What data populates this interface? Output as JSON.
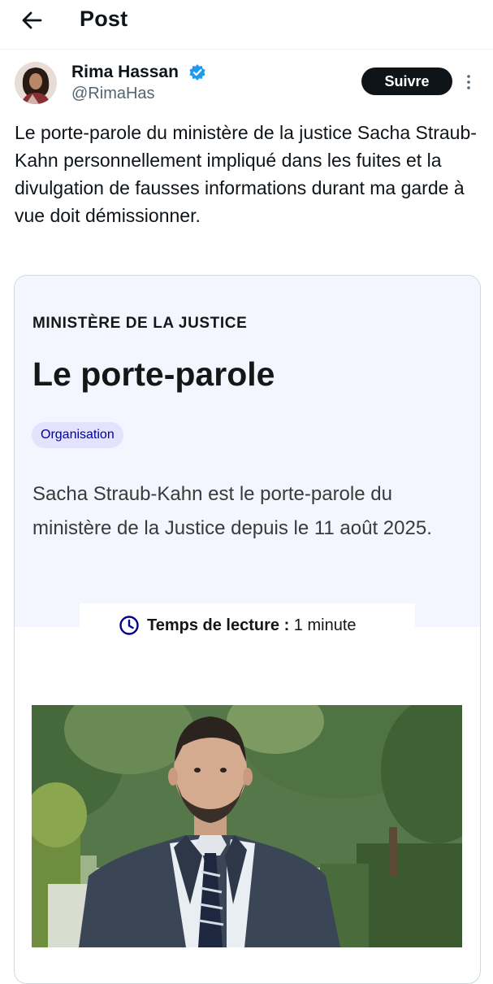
{
  "header": {
    "title": "Post"
  },
  "author": {
    "name": "Rima Hassan",
    "handle": "@RimaHas",
    "verified_color": "#1d9bf0"
  },
  "follow_label": "Suivre",
  "tweet_text": "Le porte-parole du ministère de la justice Sacha Straub-Kahn personnellement impliqué dans les fuites et la divulgation de fausses informations durant ma garde à vue doit démissionner.",
  "card": {
    "organization": "MINISTÈRE DE LA JUSTICE",
    "title": "Le porte-parole",
    "tag": "Organisation",
    "description": "Sacha Straub-Kahn est le porte-parole du ministère de la Justice depuis le 11 août 2025.",
    "reading_label": "Temps de lecture :",
    "reading_value": "1 minute"
  },
  "colors": {
    "text": "#0f1419",
    "secondary": "#536471",
    "accent": "#000091",
    "card_bg": "#f3f6fe"
  },
  "icons": [
    "back-arrow-icon",
    "verified-badge-icon",
    "more-options-icon",
    "clock-icon"
  ]
}
